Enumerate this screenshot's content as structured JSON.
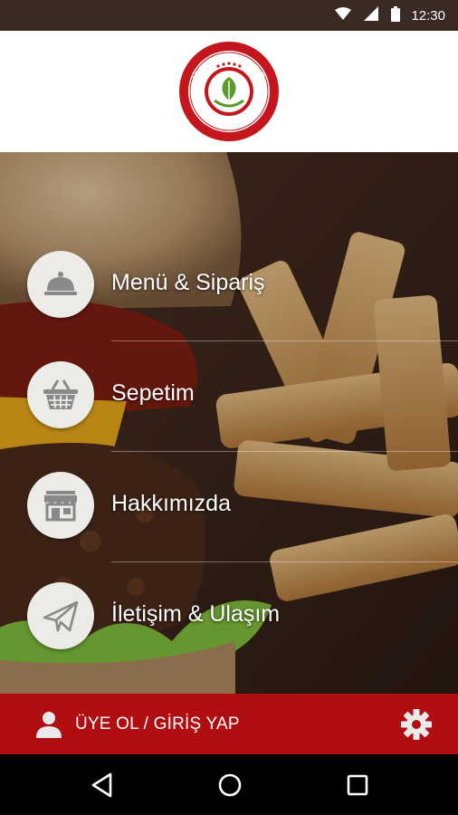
{
  "status_bar": {
    "time": "12:30",
    "icons": [
      "wifi-icon",
      "signal-icon",
      "battery-icon"
    ]
  },
  "header": {
    "logo": {
      "top_text": "KOŞK KASAP",
      "bottom_text": "BURGER & STEAK HOUSE",
      "ring_color": "#c4161c"
    }
  },
  "menu": {
    "items": [
      {
        "label": "Menü & Sipariş",
        "icon": "cloche-icon"
      },
      {
        "label": "Sepetim",
        "icon": "basket-icon"
      },
      {
        "label": "Hakkımızda",
        "icon": "storefront-icon"
      },
      {
        "label": "İletişim & Ulaşım",
        "icon": "paper-plane-icon"
      }
    ]
  },
  "account_bar": {
    "label": "ÜYE OL / GİRİŞ YAP",
    "icon": "user-icon",
    "settings_icon": "gear-icon",
    "color": "#b10e12"
  },
  "nav_bar": {
    "buttons": [
      "back-icon",
      "home-icon",
      "recents-icon"
    ]
  }
}
